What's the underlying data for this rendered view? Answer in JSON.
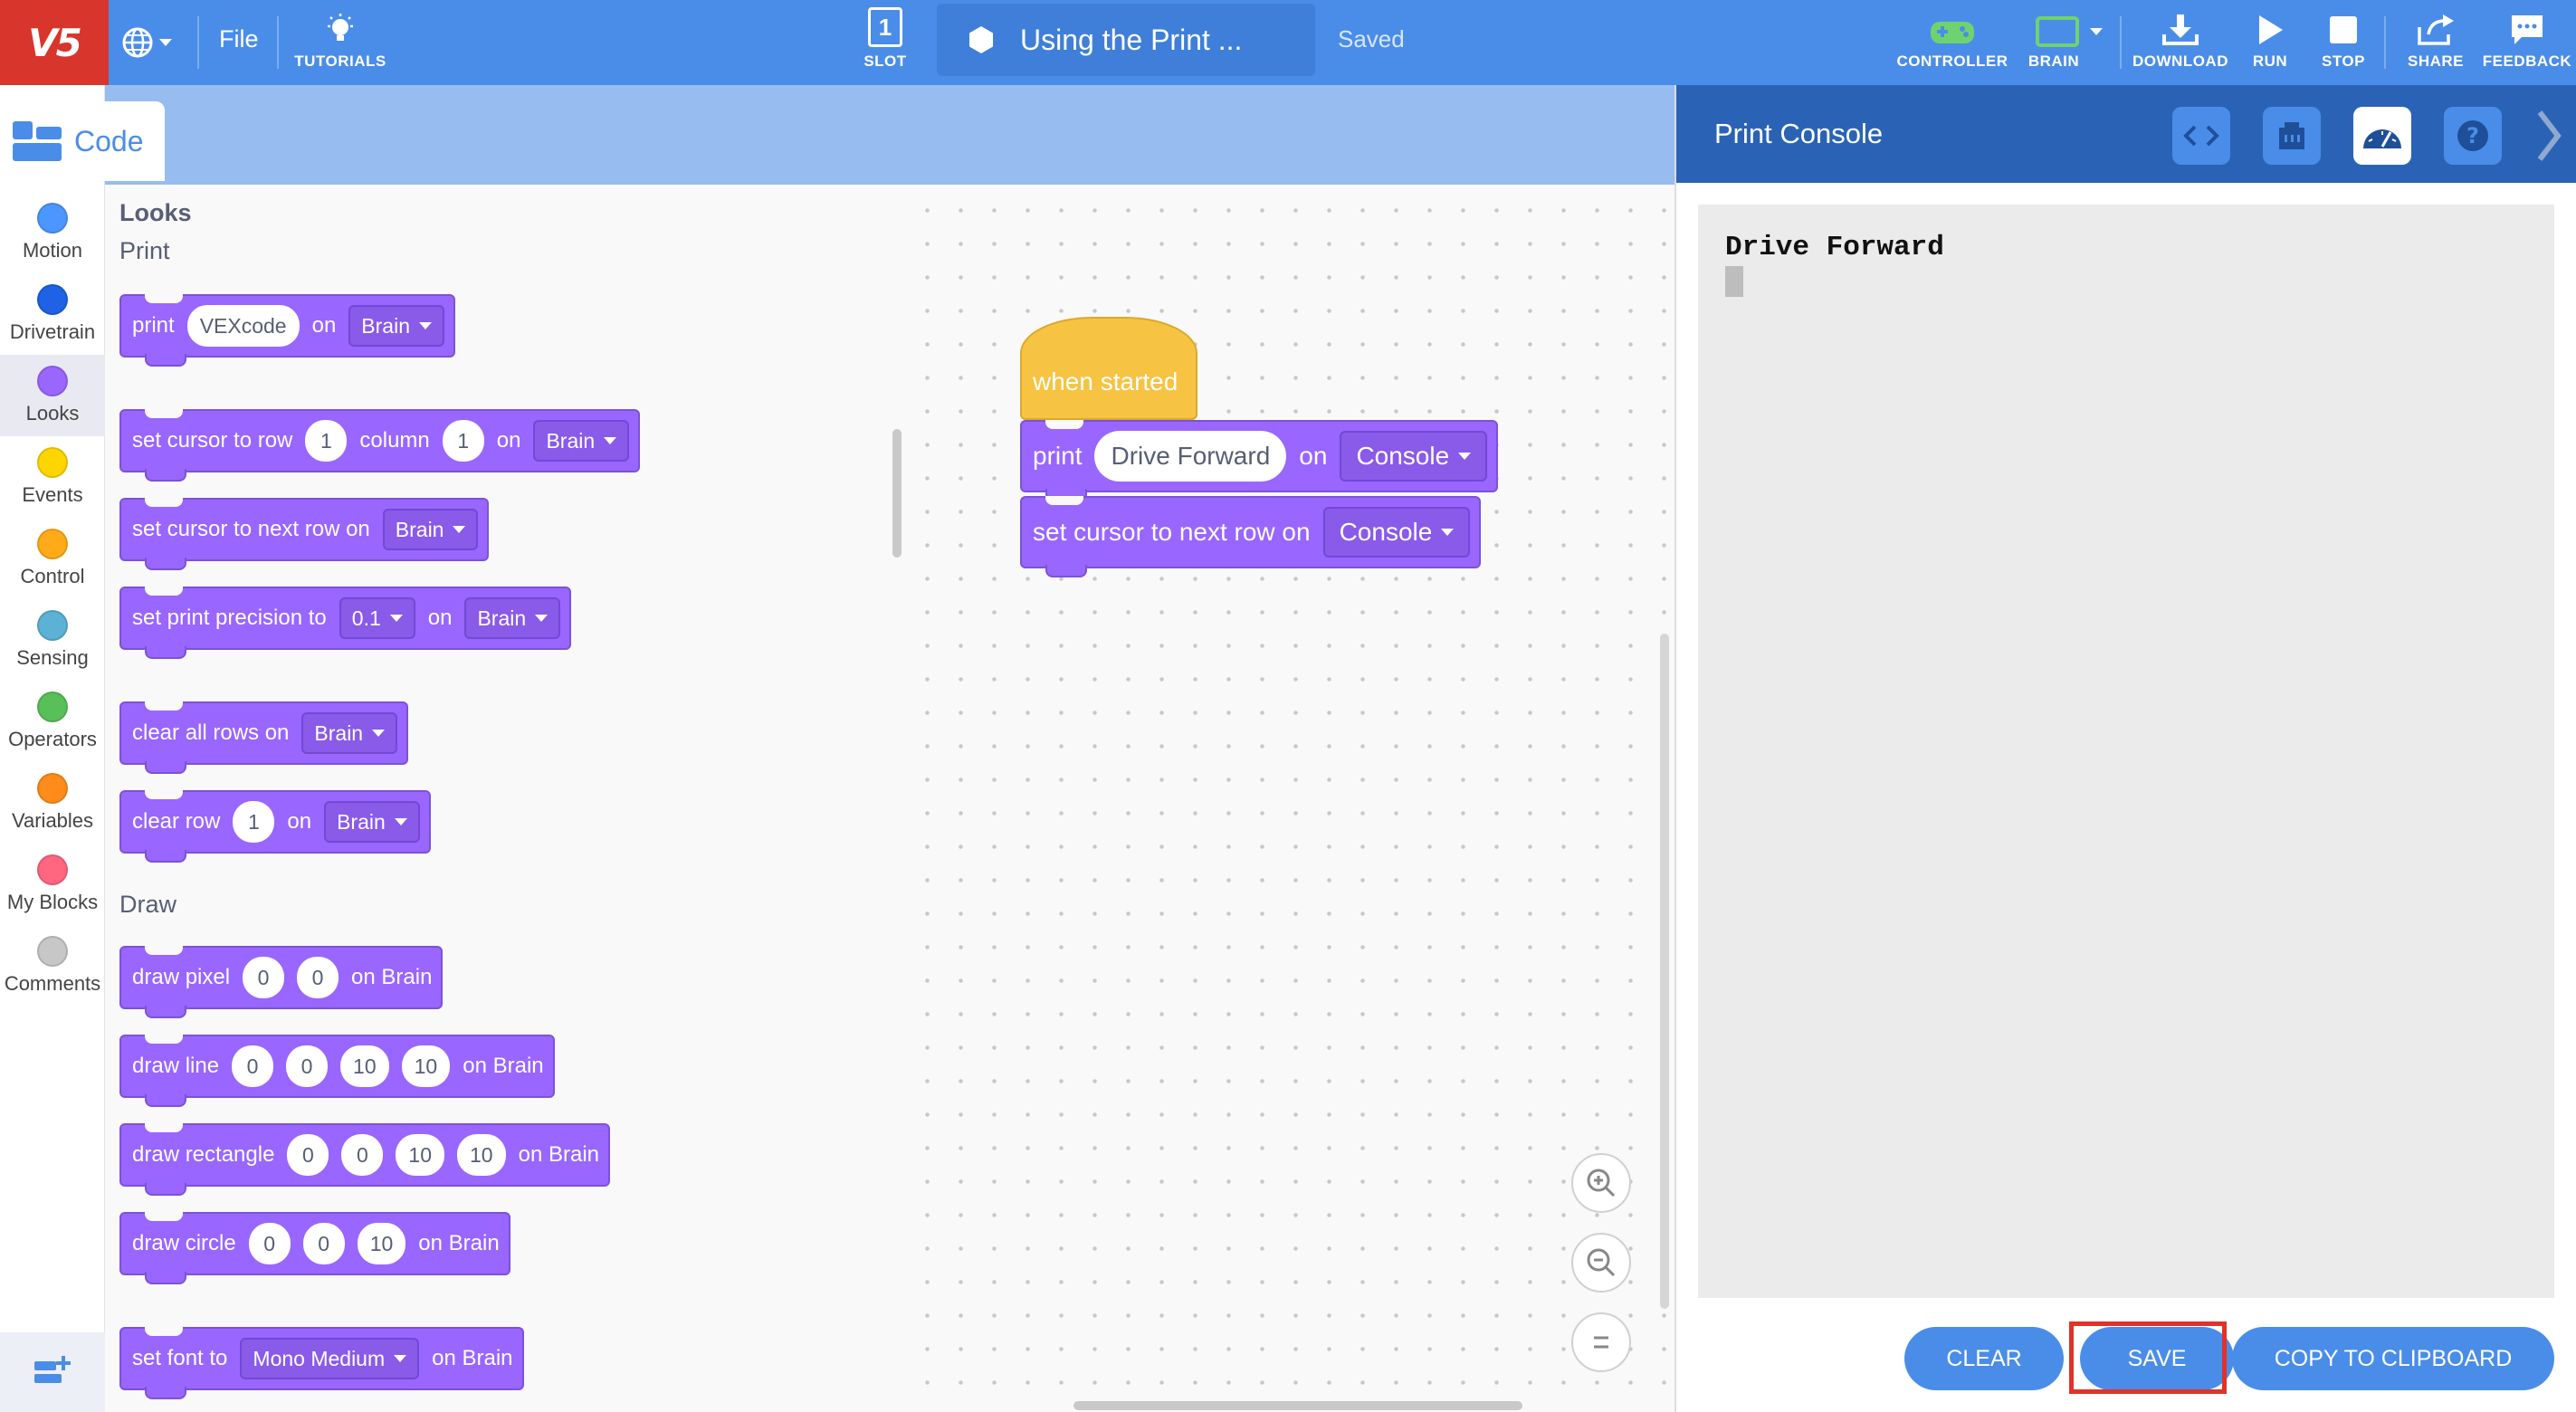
{
  "topbar": {
    "logo": "V5",
    "file_label": "File",
    "tutorials_label": "TUTORIALS",
    "slot_number": "1",
    "slot_label": "SLOT",
    "project_title": "Using the Print ...",
    "status": "Saved",
    "controller_label": "CONTROLLER",
    "brain_label": "BRAIN",
    "download_label": "DOWNLOAD",
    "run_label": "RUN",
    "stop_label": "STOP",
    "share_label": "SHARE",
    "feedback_label": "FEEDBACK"
  },
  "sidebar": {
    "code_tab": "Code",
    "categories": [
      {
        "label": "Motion",
        "color": "#4c97ff"
      },
      {
        "label": "Drivetrain",
        "color": "#1f62e6"
      },
      {
        "label": "Looks",
        "color": "#9966ff"
      },
      {
        "label": "Events",
        "color": "#ffd500"
      },
      {
        "label": "Control",
        "color": "#ffab19"
      },
      {
        "label": "Sensing",
        "color": "#5cb1d6"
      },
      {
        "label": "Operators",
        "color": "#59c059"
      },
      {
        "label": "Variables",
        "color": "#ff8c1a"
      },
      {
        "label": "My Blocks",
        "color": "#ff6680"
      },
      {
        "label": "Comments",
        "color": "#c7c7c7"
      }
    ]
  },
  "flyout": {
    "category_title": "Looks",
    "print_header": "Print",
    "draw_header": "Draw",
    "print_block": {
      "label": "print",
      "value": "VEXcode",
      "on": "on",
      "target": "Brain"
    },
    "cursor_block": {
      "label": "set cursor to row",
      "row": "1",
      "column_label": "column",
      "column": "1",
      "on": "on",
      "target": "Brain"
    },
    "next_row_block": {
      "label": "set cursor to next row on",
      "target": "Brain"
    },
    "precision_block": {
      "label": "set print precision to",
      "value": "0.1",
      "on": "on",
      "target": "Brain"
    },
    "clear_all_block": {
      "label": "clear all rows on",
      "target": "Brain"
    },
    "clear_row_block": {
      "label": "clear row",
      "value": "1",
      "on": "on",
      "target": "Brain"
    },
    "draw_pixel_block": {
      "label": "draw pixel",
      "x": "0",
      "y": "0",
      "suffix": "on Brain"
    },
    "draw_line_block": {
      "label": "draw line",
      "x1": "0",
      "y1": "0",
      "x2": "10",
      "y2": "10",
      "suffix": "on Brain"
    },
    "draw_rect_block": {
      "label": "draw rectangle",
      "x": "0",
      "y": "0",
      "w": "10",
      "h": "10",
      "suffix": "on Brain"
    },
    "draw_circle_block": {
      "label": "draw circle",
      "x": "0",
      "y": "0",
      "r": "10",
      "suffix": "on Brain"
    },
    "font_block": {
      "label": "set font to",
      "value": "Mono Medium",
      "suffix": "on Brain"
    }
  },
  "workspace": {
    "hat_label": "when started",
    "print_label": "print",
    "print_value": "Drive Forward",
    "print_on": "on",
    "print_target": "Console",
    "next_row_label": "set cursor to next row on",
    "next_row_target": "Console"
  },
  "console_panel": {
    "title": "Print Console",
    "output": "Drive Forward",
    "clear_label": "CLEAR",
    "save_label": "SAVE",
    "copy_label": "COPY TO CLIPBOARD"
  }
}
